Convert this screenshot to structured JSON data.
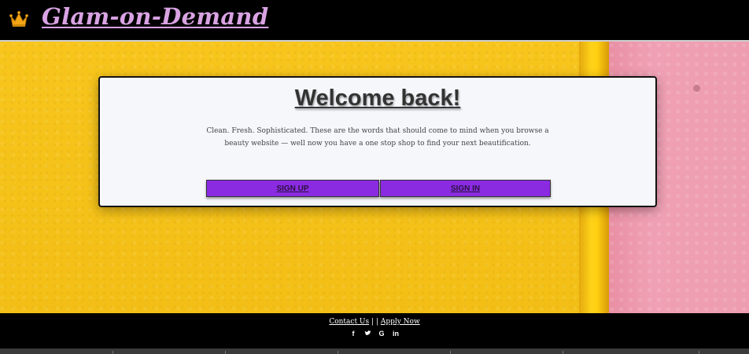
{
  "header": {
    "brand": "Glam-on-Demand",
    "crown_icon": "crown-icon"
  },
  "card": {
    "title": "Welcome back!",
    "text": "Clean. Fresh. Sophisticated. These are the words that should come to mind when you browse a beauty website — well now you have a one stop shop to find your next beautification.",
    "signup_label": "SIGN UP",
    "signin_label": "SIGN IN"
  },
  "footer": {
    "contact_label": "Contact Us",
    "separator": "| |",
    "apply_label": "Apply Now",
    "socials": [
      "f",
      "🐦",
      "G",
      "in"
    ]
  },
  "colors": {
    "accent": "#8a2be2",
    "brand": "#d9a3e3",
    "background_yellow": "#f5c218",
    "background_pink": "#ee9db0"
  }
}
